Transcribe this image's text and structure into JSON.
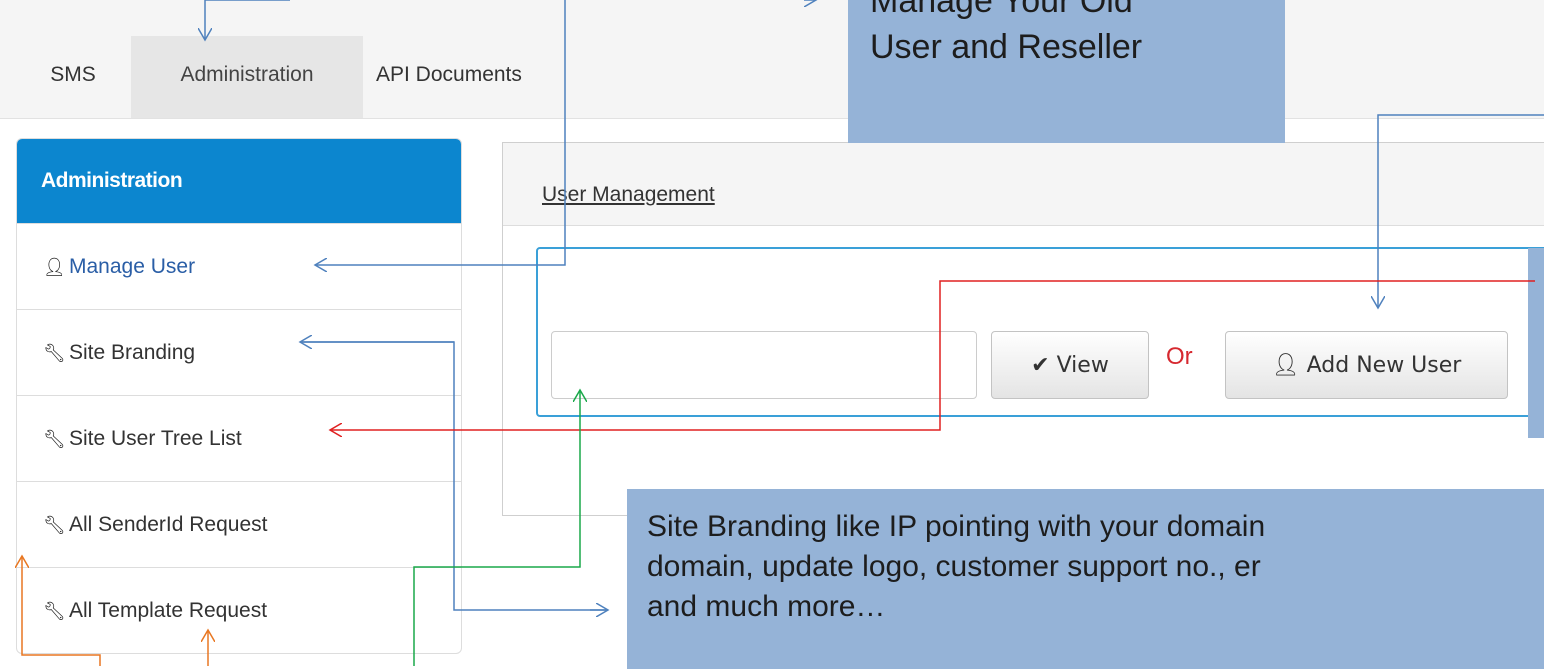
{
  "tabs": [
    {
      "label": "SMS"
    },
    {
      "label": "Administration"
    },
    {
      "label": "API Documents"
    }
  ],
  "sidebar": {
    "title": "Administration",
    "items": [
      {
        "label": "Manage User",
        "icon": "user-icon"
      },
      {
        "label": "Site Branding",
        "icon": "wrench-icon"
      },
      {
        "label": "Site User Tree List",
        "icon": "wrench-icon"
      },
      {
        "label": "All SenderId Request",
        "icon": "wrench-icon"
      },
      {
        "label": "All Template Request",
        "icon": "wrench-icon"
      }
    ]
  },
  "panel": {
    "title": "User Management",
    "search": {
      "value": "",
      "placeholder": ""
    },
    "view_button": "View",
    "or_text": "Or",
    "add_button": "Add New User"
  },
  "callouts": {
    "top_line1": "Manage Your Old",
    "top_line2": "User and Reseller",
    "bottom_line1": "Site Branding like IP pointing with your domain",
    "bottom_line2": "domain, update logo, customer support no., er",
    "bottom_line3": "and much more…"
  },
  "colors": {
    "accent": "#0c86cf",
    "callout": "#95b3d7",
    "arrow_blue": "#4f81bd",
    "arrow_red": "#e02020",
    "arrow_green": "#1aa84a",
    "arrow_orange": "#e87722"
  }
}
